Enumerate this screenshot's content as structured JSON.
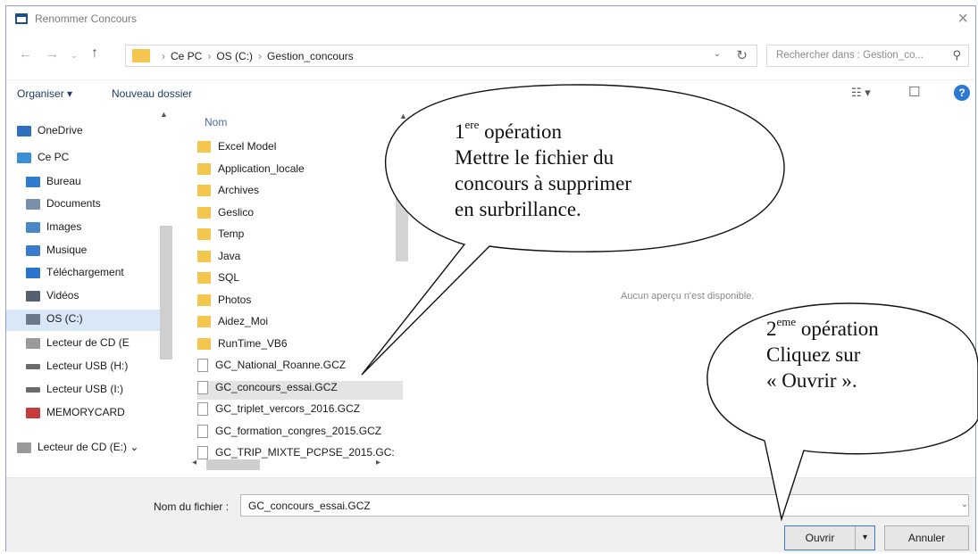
{
  "window": {
    "title": "Renommer Concours",
    "close_icon": "close-icon"
  },
  "address": {
    "crumbs": [
      "Ce PC",
      "OS (C:)",
      "Gestion_concours"
    ],
    "search_placeholder": "Rechercher dans : Gestion_co..."
  },
  "toolbar": {
    "organize_label": "Organiser ▾",
    "new_folder_label": "Nouveau dossier"
  },
  "nav": {
    "items": [
      {
        "label": "OneDrive",
        "color": "#2e6fc0"
      },
      {
        "label": "Ce PC",
        "color": "#3a8fd6"
      },
      {
        "label": "Bureau",
        "color": "#2f7dd1"
      },
      {
        "label": "Documents",
        "color": "#7a8fa8"
      },
      {
        "label": "Images",
        "color": "#4b86c6"
      },
      {
        "label": "Musique",
        "color": "#3a7bd0"
      },
      {
        "label": "Téléchargement",
        "color": "#2a74d0"
      },
      {
        "label": "Vidéos",
        "color": "#556070"
      },
      {
        "label": "OS (C:)",
        "color": "#6a7a8a"
      },
      {
        "label": "Lecteur de CD (E",
        "color": "#9a9a9a"
      },
      {
        "label": "Lecteur USB (H:)",
        "color": "#6a6a6a"
      },
      {
        "label": "Lecteur USB (I:)",
        "color": "#6a6a6a"
      },
      {
        "label": "MEMORYCARD",
        "color": "#c83b3b"
      },
      {
        "label": "Lecteur de CD (E:) ⌄",
        "color": "#9a9a9a"
      }
    ]
  },
  "files": {
    "column": "Nom",
    "items": [
      {
        "label": "Excel Model",
        "kind": "folder"
      },
      {
        "label": "Application_locale",
        "kind": "folder"
      },
      {
        "label": "Archives",
        "kind": "folder"
      },
      {
        "label": "Geslico",
        "kind": "folder"
      },
      {
        "label": "Temp",
        "kind": "folder"
      },
      {
        "label": "Java",
        "kind": "folder"
      },
      {
        "label": "SQL",
        "kind": "folder"
      },
      {
        "label": "Photos",
        "kind": "folder"
      },
      {
        "label": "Aidez_Moi",
        "kind": "folder"
      },
      {
        "label": "RunTime_VB6",
        "kind": "folder"
      },
      {
        "label": "GC_National_Roanne.GCZ",
        "kind": "file"
      },
      {
        "label": "GC_concours_essai.GCZ",
        "kind": "file"
      },
      {
        "label": "GC_triplet_vercors_2016.GCZ",
        "kind": "file"
      },
      {
        "label": "GC_formation_congres_2015.GCZ",
        "kind": "file"
      },
      {
        "label": "GC_TRIP_MIXTE_PCPSE_2015.GC:",
        "kind": "file"
      }
    ],
    "selected_index": 11
  },
  "preview": {
    "empty_text": "Aucun aperçu n'est disponible."
  },
  "bottom": {
    "filename_label": "Nom du fichier :",
    "filename_value": "GC_concours_essai.GCZ",
    "open_label": "Ouvrir",
    "cancel_label": "Annuler"
  },
  "callouts": {
    "first": {
      "num": "1",
      "sup": "ere",
      "word": " opération",
      "lines": [
        "Mettre le fichier du",
        "concours à supprimer",
        "en surbrillance."
      ]
    },
    "second": {
      "num": "2",
      "sup": "eme",
      "word": " opération",
      "lines": [
        "Cliquez sur",
        "« Ouvrir »."
      ]
    }
  },
  "colors": {
    "accent": "#2b79d0",
    "selection": "#d9e7f6",
    "folder": "#f4c64e"
  }
}
